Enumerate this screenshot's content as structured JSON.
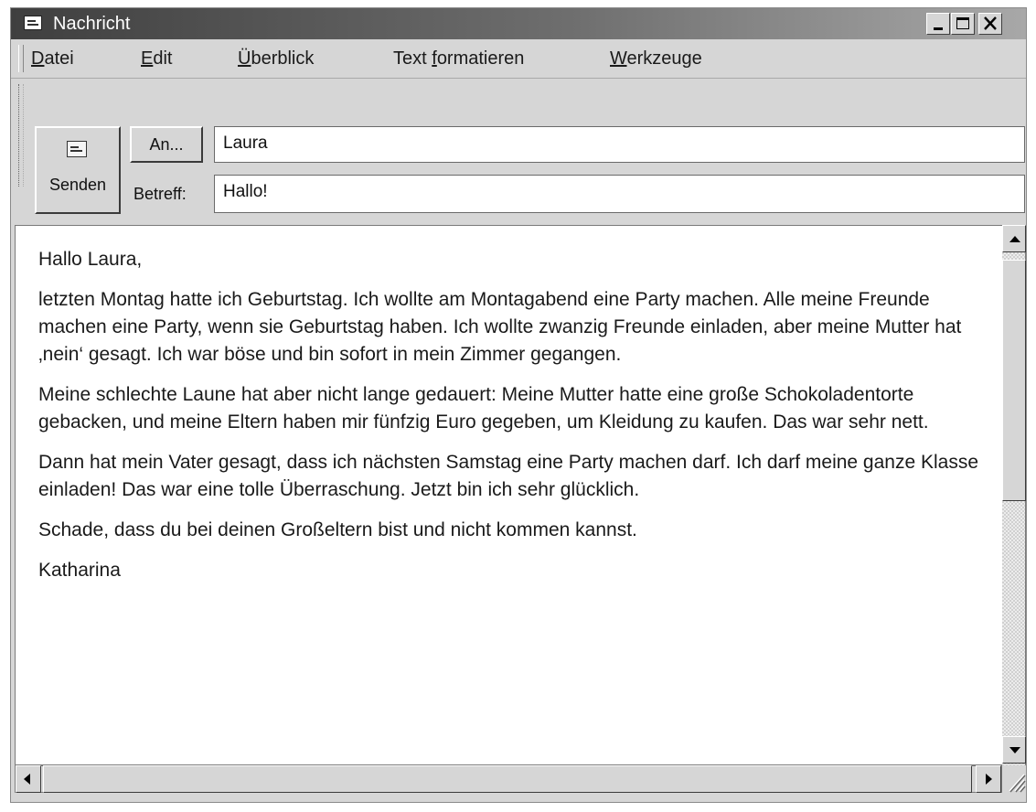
{
  "window": {
    "title": "Nachricht"
  },
  "menu": {
    "items": [
      {
        "underline": "D",
        "rest": "atei"
      },
      {
        "underline": "E",
        "rest": "dit"
      },
      {
        "underline": "Ü",
        "rest": "berblick"
      },
      {
        "pre": "Text ",
        "underline": "f",
        "rest": "ormatieren"
      },
      {
        "underline": "W",
        "rest": "erkzeuge"
      }
    ]
  },
  "compose": {
    "send_label": "Senden",
    "to_button": "An...",
    "to_value": "Laura",
    "subject_label": "Betreff:",
    "subject_value": "Hallo!"
  },
  "message": {
    "paragraphs": [
      "Hallo Laura,",
      "letzten Montag hatte ich Geburtstag. Ich wollte am Montagabend eine Party machen. Alle meine Freunde machen eine Party, wenn sie Geburtstag haben. Ich wollte zwanzig Freunde einladen, aber meine Mutter hat ‚nein‘ gesagt. Ich war böse und bin sofort in mein Zimmer gegangen.",
      "Meine schlechte Laune hat aber nicht lange gedauert: Meine Mutter hatte eine große Schokoladentorte gebacken, und meine Eltern haben mir fünfzig Euro gegeben, um Kleidung zu kaufen. Das war sehr nett.",
      "Dann hat mein Vater gesagt, dass ich nächsten Samstag eine Party machen darf. Ich darf meine ganze Klasse einladen! Das war eine tolle Überraschung. Jetzt bin ich sehr glücklich.",
      "Schade, dass du bei deinen Großeltern bist und nicht kommen kannst.",
      "Katharina"
    ]
  },
  "icons": {
    "window": "envelope-icon",
    "send": "envelope-icon",
    "minimize": "minimize-icon",
    "maximize": "maximize-icon",
    "close": "close-icon"
  }
}
